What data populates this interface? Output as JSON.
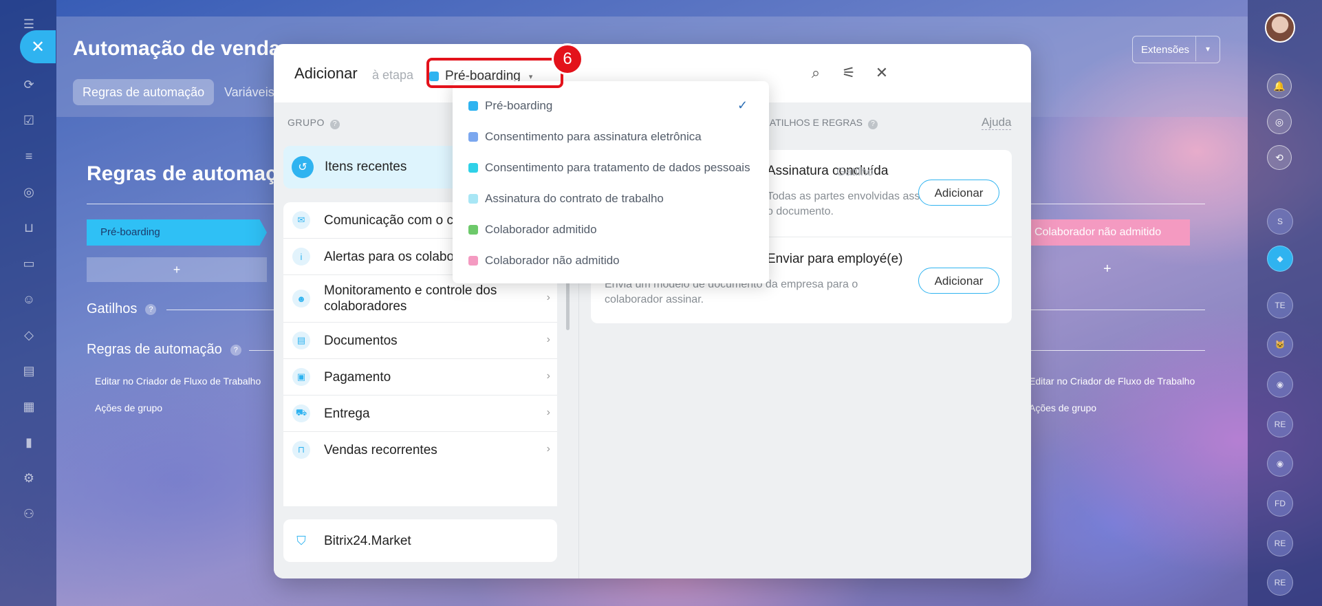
{
  "app": {
    "page_title": "Automação de vendas",
    "tabs": [
      "Regras de automação",
      "Variáveis"
    ],
    "extensions_label": "Extensões",
    "close_label": "✕"
  },
  "background": {
    "rules_title": "Regras de automação",
    "stage_first": "Pré-boarding",
    "stage_last": "Colaborador não admitido",
    "add_stage": "+",
    "triggers_label": "Gatilhos",
    "rules_label": "Regras de automação",
    "edit_link": "Editar no Criador de Fluxo de Trabalho",
    "group_actions": "Ações de grupo"
  },
  "modal": {
    "title": "Adicionar",
    "etapa": "à etapa",
    "selected_stage": "Pré-boarding",
    "step_badge": "6",
    "group_label": "GRUPO",
    "recent_label": "Itens recentes",
    "groups": [
      {
        "label": "Comunicação com o cliente",
        "icon": "chat-icon"
      },
      {
        "label": "Alertas para os colaboradores",
        "icon": "info-icon"
      },
      {
        "label": "Monitoramento e controle dos colaboradores",
        "icon": "people-icon"
      },
      {
        "label": "Documentos",
        "icon": "document-icon"
      },
      {
        "label": "Pagamento",
        "icon": "wallet-icon"
      },
      {
        "label": "Entrega",
        "icon": "truck-icon"
      },
      {
        "label": "Vendas recorrentes",
        "icon": "bag-icon"
      }
    ],
    "market_label": "Bitrix24.Market",
    "right_label": "GATILHOS E REGRAS",
    "help_label": "Ajuda",
    "items": [
      {
        "title": "Assinatura concluída",
        "tag": "Gatilho",
        "desc_lines": [
          "Todas as partes envolvidas assinaram",
          "o documento."
        ],
        "button": "Adicionar"
      },
      {
        "title": "Enviar para employé(e)",
        "tag": "",
        "desc_lines": [
          "Envia um modelo de documento da empresa para o",
          "colaborador assinar."
        ],
        "button": "Adicionar"
      }
    ]
  },
  "dropdown": {
    "items": [
      {
        "label": "Pré-boarding",
        "color": "#2fb3f0",
        "selected": true
      },
      {
        "label": "Consentimento para assinatura eletrônica",
        "color": "#7ba7ef",
        "selected": false
      },
      {
        "label": "Consentimento para tratamento de dados pessoais",
        "color": "#2fd1e8",
        "selected": false
      },
      {
        "label": "Assinatura do contrato de trabalho",
        "color": "#a8e6f5",
        "selected": false
      },
      {
        "label": "Colaborador admitido",
        "color": "#6dc96a",
        "selected": false
      },
      {
        "label": "Colaborador não admitido",
        "color": "#f49ac1",
        "selected": false
      }
    ]
  },
  "right_rail": {
    "avatars": [
      "S",
      "TE",
      "RE",
      "FD",
      "RE",
      "RE"
    ]
  }
}
